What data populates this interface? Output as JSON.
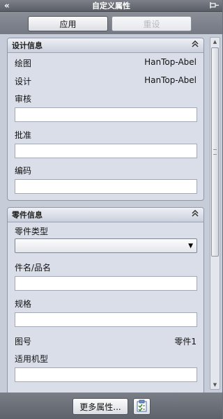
{
  "window": {
    "title": "自定义属性",
    "collapse_glyph": "«",
    "pin_glyph": "⊣"
  },
  "toolbar": {
    "apply_label": "应用",
    "reset_label": "重设"
  },
  "design_group": {
    "title": "设计信息",
    "chevron": "⌃",
    "drawing_label": "绘图",
    "drawing_value": "HanTop-Abel",
    "designer_label": "设计",
    "designer_value": "HanTop-Abel",
    "review_label": "审核",
    "review_value": "",
    "approve_label": "批准",
    "approve_value": "",
    "code_label": "编码",
    "code_value": ""
  },
  "part_group": {
    "title": "零件信息",
    "chevron": "⌃",
    "type_label": "零件类型",
    "type_value": "",
    "name_label": "件名/品名",
    "name_value": "",
    "spec_label": "规格",
    "spec_value": "",
    "drawing_no_label": "图号",
    "drawing_no_value": "零件1",
    "model_label": "适用机型",
    "model_value": ""
  },
  "footer": {
    "more_label": "更多属性..."
  },
  "colors": {
    "panel_bg": "#c6ccd8",
    "group_bg": "#d9dee9",
    "chrome_dark": "#5a5e66"
  }
}
